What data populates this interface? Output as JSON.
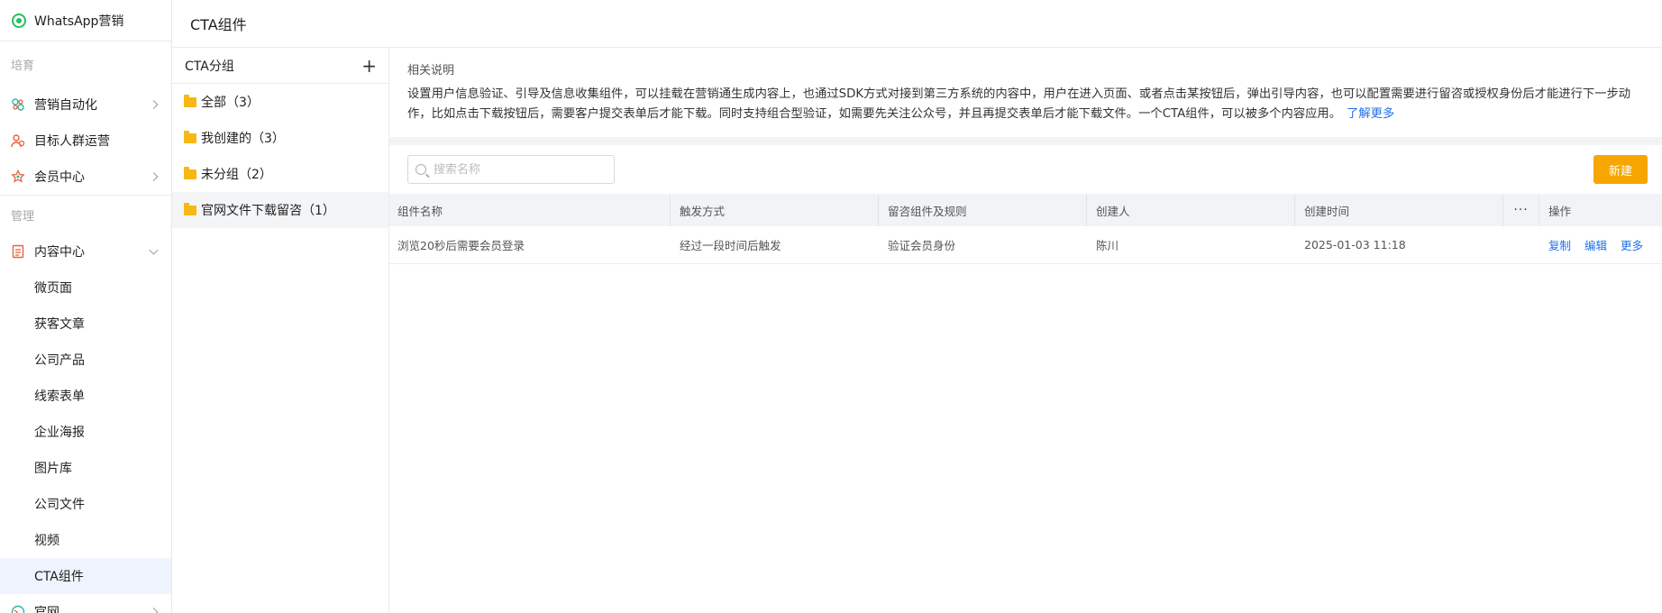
{
  "sidebar": {
    "brand": "WhatsApp营销",
    "section1": "培育",
    "items1": [
      {
        "label": "营销自动化",
        "icon": "automation-icon"
      },
      {
        "label": "目标人群运营",
        "icon": "audience-icon"
      },
      {
        "label": "会员中心",
        "icon": "member-icon"
      }
    ],
    "section2": "管理",
    "content_center": {
      "label": "内容中心",
      "icon": "content-icon"
    },
    "sub_items": [
      "微页面",
      "获客文章",
      "公司产品",
      "线索表单",
      "企业海报",
      "图片库",
      "公司文件",
      "视频",
      "CTA组件"
    ],
    "active_sub": "CTA组件",
    "partial_item": {
      "label": "官网",
      "icon": "website-icon"
    }
  },
  "topbar": {
    "title": "CTA组件"
  },
  "groups": {
    "title": "CTA分组",
    "items": [
      {
        "label": "全部（3）"
      },
      {
        "label": "我创建的（3）"
      },
      {
        "label": "未分组（2）"
      },
      {
        "label": "官网文件下载留咨（1）"
      }
    ]
  },
  "description": {
    "title": "相关说明",
    "text": "设置用户信息验证、引导及信息收集组件，可以挂载在营销通生成内容上，也通过SDK方式对接到第三方系统的内容中，用户在进入页面、或者点击某按钮后，弹出引导内容，也可以配置需要进行留咨或授权身份后才能进行下一步动作，比如点击下载按钮后，需要客户提交表单后才能下载。同时支持组合型验证，如需要先关注公众号，并且再提交表单后才能下载文件。一个CTA组件，可以被多个内容应用。",
    "link": "了解更多"
  },
  "toolbar": {
    "search_placeholder": "搜索名称",
    "new_button": "新建"
  },
  "table": {
    "headers": [
      "组件名称",
      "触发方式",
      "留咨组件及规则",
      "创建人",
      "创建时间",
      "···",
      "操作"
    ],
    "rows": [
      {
        "name": "浏览20秒后需要会员登录",
        "trigger": "经过一段时间后触发",
        "rule": "验证会员身份",
        "creator": "陈川",
        "created": "2025-01-03 11:18",
        "actions": [
          "复制",
          "编辑",
          "更多"
        ]
      }
    ]
  },
  "colors": {
    "accent": "#f7a600",
    "link": "#1e6ff0",
    "whatsapp": "#25c05f"
  }
}
